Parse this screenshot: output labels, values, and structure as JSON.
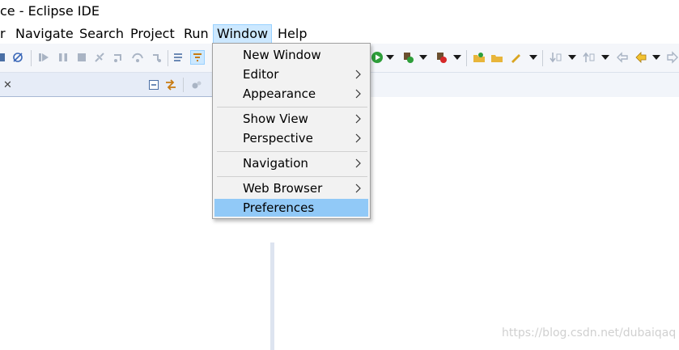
{
  "window": {
    "title": "ce - Eclipse IDE"
  },
  "menu_bar": {
    "items": [
      {
        "label": "r"
      },
      {
        "label": "Navigate"
      },
      {
        "label": "Search"
      },
      {
        "label": "Project"
      },
      {
        "label": "Run"
      },
      {
        "label": "Window"
      },
      {
        "label": "Help"
      }
    ],
    "active": "Window"
  },
  "window_menu": {
    "items": [
      {
        "label": "New Window",
        "submenu": false
      },
      {
        "label": "Editor",
        "submenu": true
      },
      {
        "label": "Appearance",
        "submenu": true
      },
      {
        "label": "Show View",
        "submenu": true
      },
      {
        "label": "Perspective",
        "submenu": true
      },
      {
        "label": "Navigation",
        "submenu": true
      },
      {
        "label": "Web Browser",
        "submenu": true
      },
      {
        "label": "Preferences",
        "submenu": false
      }
    ],
    "selected": "Preferences"
  },
  "view": {
    "close_glyph": "✕"
  },
  "watermark": {
    "text": "https://blog.csdn.net/dubaiqaq"
  },
  "colors": {
    "menu_active": "#cce8ff",
    "menu_selected": "#91c9f7",
    "menu_background": "#f2f2f2",
    "toolbar_background": "#f4f6fa",
    "view_tab_background": "#e6ecf7",
    "run_green": "#2e9e3a",
    "stop_red": "#d62828",
    "folder_yellow": "#e8b53a"
  },
  "icons": {
    "toolbar": [
      "debug-skip-icon",
      "resume-icon",
      "suspend-icon",
      "terminate-icon",
      "disconnect-icon",
      "step-into-icon",
      "step-over-icon",
      "step-return-icon",
      "drop-to-frame-icon",
      "use-step-filters-icon",
      "run-icon",
      "debug-run-icon",
      "external-tools-icon",
      "new-package-icon",
      "open-type-icon",
      "search-tool-icon",
      "next-annotation-icon",
      "previous-annotation-icon",
      "last-edit-icon",
      "back-icon",
      "forward-icon"
    ],
    "view": [
      "collapse-all-icon",
      "link-with-editor-icon",
      "view-menu-icon"
    ]
  }
}
